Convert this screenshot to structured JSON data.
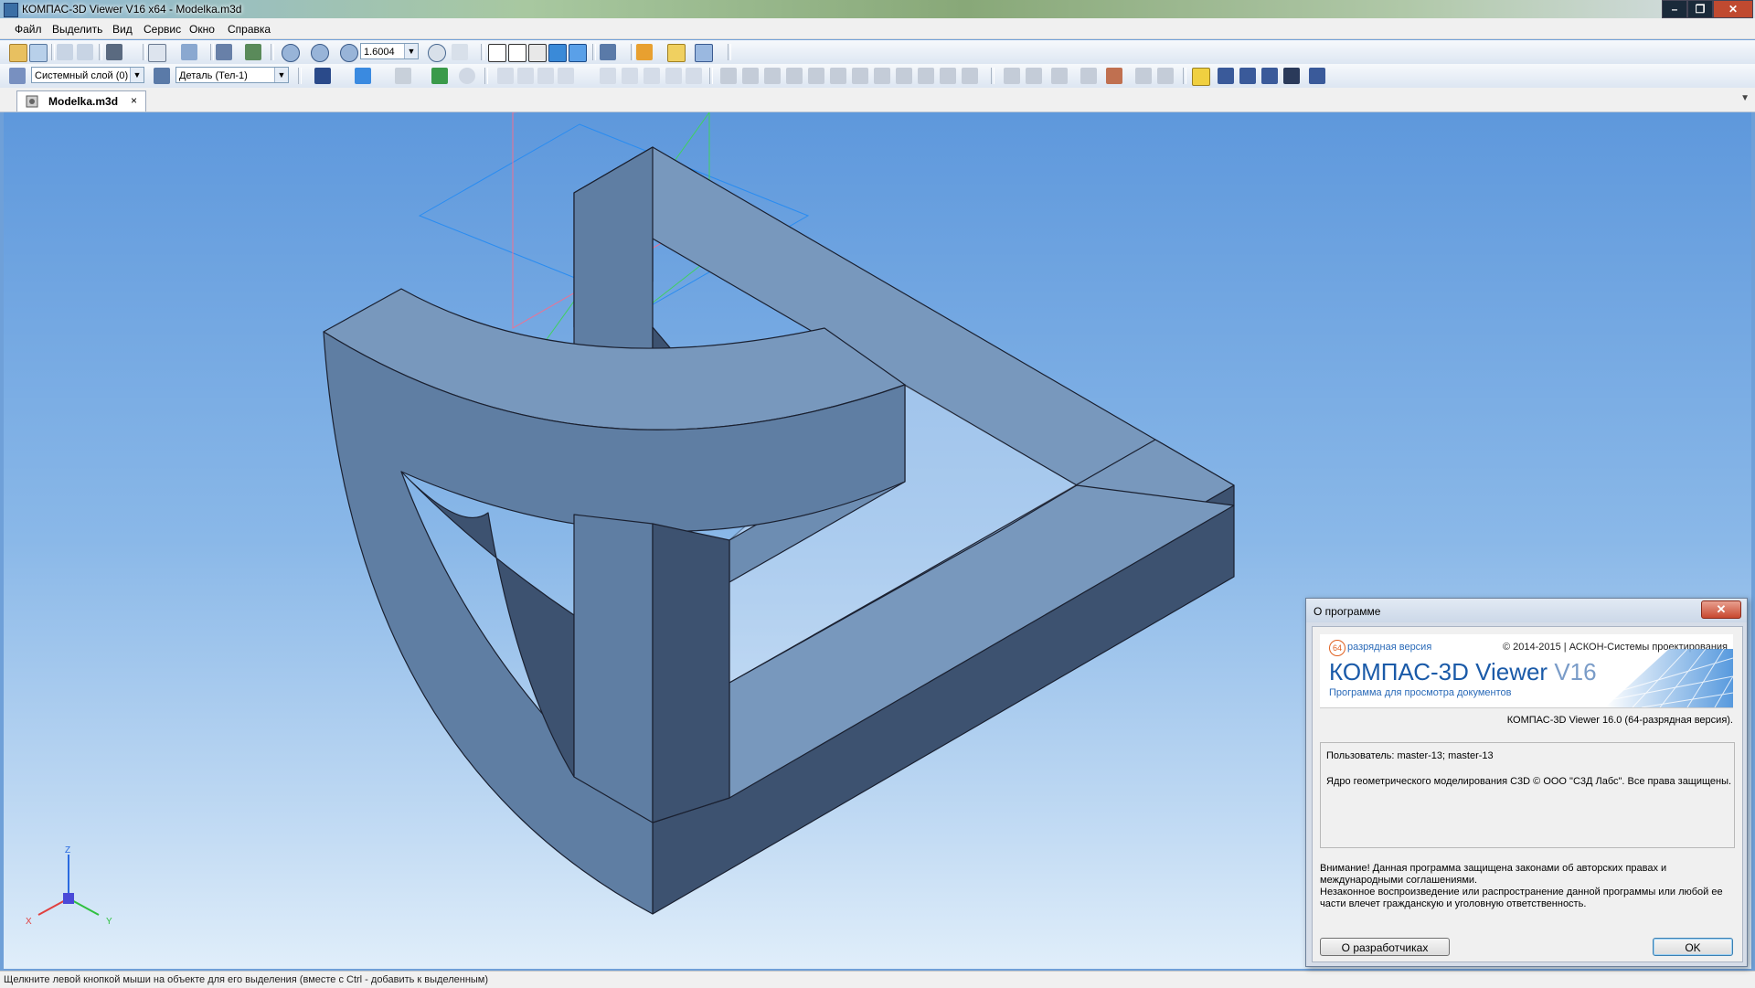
{
  "window": {
    "title": "КОМПАС-3D Viewer V16  x64 - Modelka.m3d",
    "controls": [
      "–",
      "❐",
      "✕"
    ]
  },
  "menu": {
    "items": [
      {
        "label": "Файл"
      },
      {
        "label": "Выделить"
      },
      {
        "label": "Вид"
      },
      {
        "label": "Сервис"
      },
      {
        "label": "Окно"
      },
      {
        "label": "Справка"
      }
    ]
  },
  "toolbar": {
    "zoom_value": "1.6004",
    "layer_combo": "Системный слой (0)",
    "part_combo": "Деталь (Тел-1)"
  },
  "tabs": {
    "document": "Modelka.m3d",
    "close": "×"
  },
  "axes": {
    "x": "X",
    "y": "Y",
    "z": "Z"
  },
  "status": {
    "text": "Щелкните левой кнопкой мыши на объекте для его выделения (вместе с Ctrl - добавить к выделенным)"
  },
  "dialog": {
    "title": "О программе",
    "close": "✕",
    "badge": "64",
    "bit_label": "разрядная версия",
    "copyright": "© 2014-2015 | АСКОН-Системы проектирования",
    "product_name": "КОМПАС-3D Viewer ",
    "product_version": "V16",
    "product_subtitle": "Программа для просмотра документов",
    "version_line": "КОМПАС-3D Viewer 16.0 (64-разрядная версия).",
    "user_line": "Пользователь: master-13; master-13",
    "kernel_line": "Ядро геометрического моделирования C3D © ООО \"С3Д Лабс\". Все права защищены.",
    "warning_lines": [
      "Внимание! Данная программа защищена законами об авторских правах и",
      "международными соглашениями.",
      "Незаконное воспроизведение или распространение данной программы или любой ее",
      "части влечет гражданскую и уголовную ответственность."
    ],
    "developers_button": "О разработчиках",
    "ok_button": "OK"
  },
  "colors": {
    "model_top": "#7898bd",
    "model_front": "#5f7ea3",
    "model_dark": "#3d5270",
    "viewport_top": "#5e98dc",
    "viewport_bottom": "#e0eefa"
  }
}
